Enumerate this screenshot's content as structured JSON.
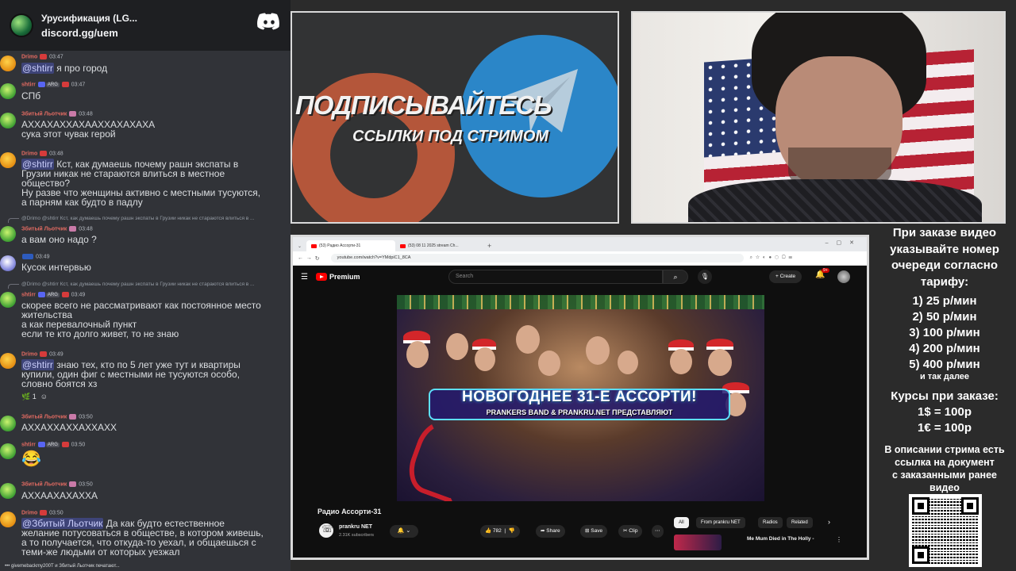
{
  "server": {
    "name": "Урусификация (LG...",
    "invite": "discord.gg/uem"
  },
  "chat": {
    "m1": {
      "user": "Drimo",
      "time": "03:47",
      "mention": "@shtirr",
      "text": " я про город"
    },
    "m2": {
      "user": "shtirr",
      "tag": "ARG",
      "time": "03:47",
      "text": "СПб"
    },
    "m3": {
      "user": "Збитый Льотчик",
      "time": "03:48",
      "text": "АХХАХАХХАХААХХАХАХАХА\nсука этот чувак герой"
    },
    "m4": {
      "user": "Drimo",
      "time": "03:48",
      "mention": "@shtirr",
      "text": " Кст, как думаешь почему рашн экспаты в\nГрузии никак не стараются влиться в местное\nобщество?\nНу разве что женщины активно с местными тусуются,\nа парням как будто в падлу"
    },
    "m5": {
      "reply": "@Drimo @shtirr Кст, как думаешь почему рашн экспаты в Грузии никак не стараются влиться в ...",
      "user": "Збитый Льотчик",
      "time": "03:48",
      "text": "а вам оно надо ?"
    },
    "m6": {
      "time": "03:49",
      "text": "Кусок интервью"
    },
    "m7": {
      "reply": "@Drimo @shtirr Кст, как думаешь почему рашн экспаты в Грузии никак не стараются влиться в ...",
      "user": "shtirr",
      "tag": "ARG",
      "time": "03:49",
      "text": "скорее всего не рассматривают как постоянное место\nжительства\nа как перевалочный пункт\nесли те кто долго живет, то не знаю"
    },
    "m8": {
      "user": "Drimo",
      "time": "03:49",
      "mention": "@shtirr",
      "text": " знаю тех, кто по 5 лет уже тут и квартиры\nкупили, один фиг с местными не тусуются особо,\nсловно боятся хз",
      "reaction_count": "1"
    },
    "m9": {
      "user": "Збитый Льотчик",
      "time": "03:50",
      "text": "АХХАХХАХХАХХАХХ"
    },
    "m10": {
      "user": "shtirr",
      "tag": "ARG",
      "time": "03:50",
      "emoji": "😂"
    },
    "m11": {
      "user": "Збитый Льотчик",
      "time": "03:50",
      "text": "АХХААХАХАХХА"
    },
    "m12": {
      "user": "Drimo",
      "time": "03:50",
      "mention": "@Збитый Льотчик",
      "text": " Да как будто естественное\nжелание потусоваться в обществе, в котором живешь,\nа то получается, что откуда-то уехал, и общаешься с\nтеми-же людьми от которых уезжал"
    },
    "typing": "givemebackmy200T и Збитый Льотчик печатают..."
  },
  "promo": {
    "title": "ПОДПИСЫВАЙТЕСЬ",
    "subtitle": "ССЫЛКИ ПОД СТРИМОМ"
  },
  "browser": {
    "tab1": "(53) Радио Ассорти-31",
    "tab2": "(53) 08 11 2025 stream Ch...",
    "url": "youtube.com/watch?v=YMdpiC1_8CA",
    "search_placeholder": "Search",
    "premium_label": "Premium",
    "create_label": "Create",
    "notif_count": "9+",
    "player": {
      "title": "НОВОГОДНЕЕ 31-Е АССОРТИ!",
      "subtitle": "PRANKERS BAND & PRANKRU.NET ПРЕДСТАВЛЯЮТ"
    },
    "video_title": "Радио Ассорти-31",
    "channel": "prankru NET",
    "subscribers": "2.31K subscribers",
    "likes": "782",
    "share": "Share",
    "save": "Save",
    "clip": "Clip",
    "chips": [
      "All",
      "From prankru NET",
      "Radios",
      "Related"
    ],
    "rec_title": "Me Mum Died in The Holly -"
  },
  "pricing": {
    "header": "При заказе видео\nуказывайте номер\nочереди согласно\nтарифу:",
    "tiers": [
      "1) 25 р/мин",
      "2) 50 р/мин",
      "3) 100 р/мин",
      "4) 200 р/мин",
      "5) 400 р/мин"
    ],
    "etc": "и так далее",
    "rates_title": "Курсы при заказе:",
    "rate_usd": "1$ = 100р",
    "rate_eur": "1€ = 100р",
    "note": "В описании стрима есть\nссылка на документ\nс заказанными ранее\nвидео"
  },
  "colors": {
    "discord_bg": "#313338",
    "username_red": "#e36b62",
    "youtube_red": "#ff0000"
  }
}
